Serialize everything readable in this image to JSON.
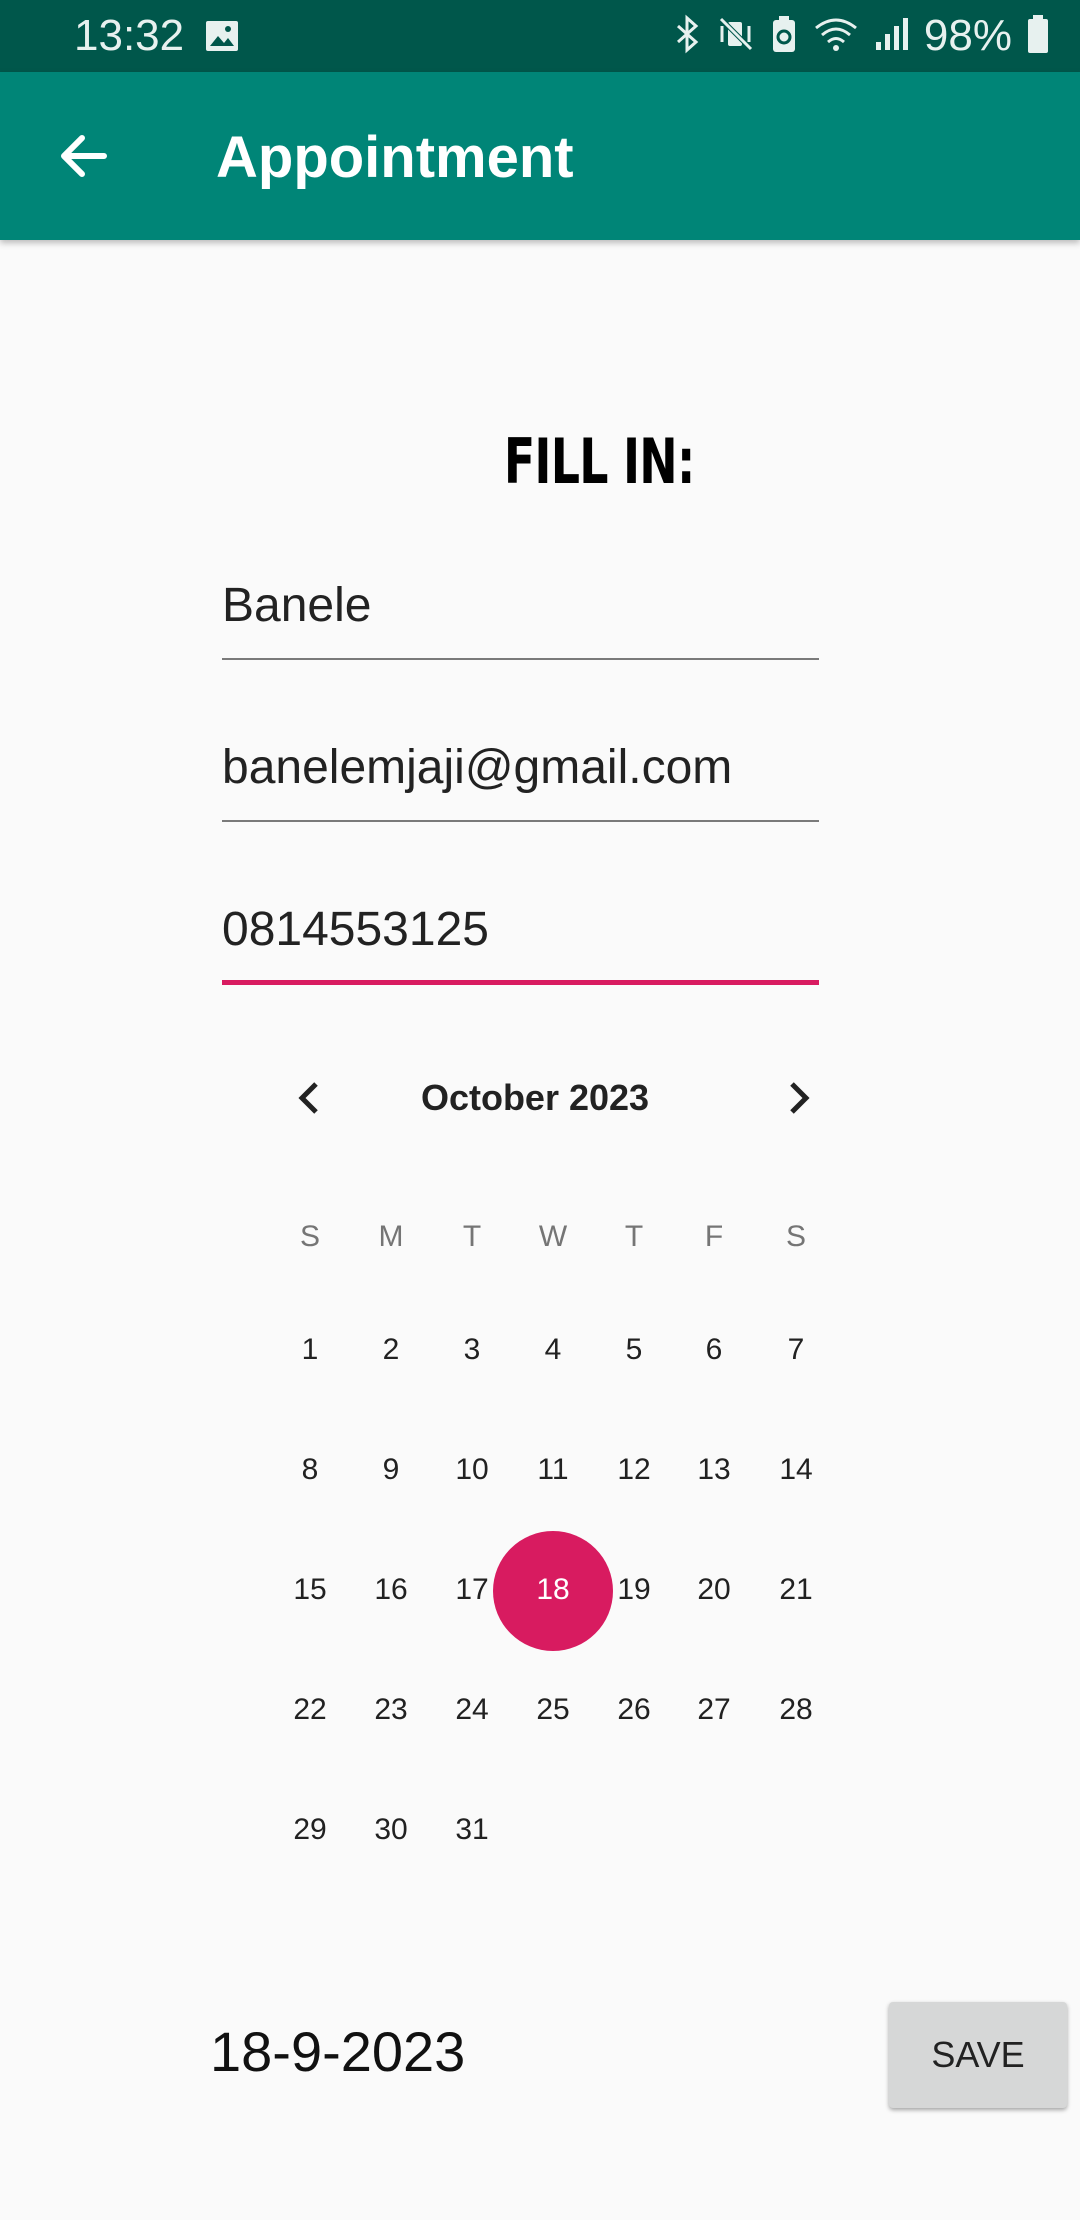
{
  "status_bar": {
    "time": "13:32",
    "battery": "98%"
  },
  "toolbar": {
    "title": "Appointment"
  },
  "form": {
    "heading": "FILL IN:",
    "name": "Banele",
    "email": "banelemjaji@gmail.com",
    "phone": "0814553125"
  },
  "calendar": {
    "month_label": "October 2023",
    "days_of_week": [
      "S",
      "M",
      "T",
      "W",
      "T",
      "F",
      "S"
    ],
    "selected_day": "18",
    "days": [
      "1",
      "2",
      "3",
      "4",
      "5",
      "6",
      "7",
      "8",
      "9",
      "10",
      "11",
      "12",
      "13",
      "14",
      "15",
      "16",
      "17",
      "18",
      "19",
      "20",
      "21",
      "22",
      "23",
      "24",
      "25",
      "26",
      "27",
      "28",
      "29",
      "30",
      "31"
    ]
  },
  "footer": {
    "date_text": "18-9-2023",
    "save_label": "SAVE"
  },
  "colors": {
    "primary": "#008577",
    "primary_dark": "#00574b",
    "accent": "#d81b60"
  }
}
